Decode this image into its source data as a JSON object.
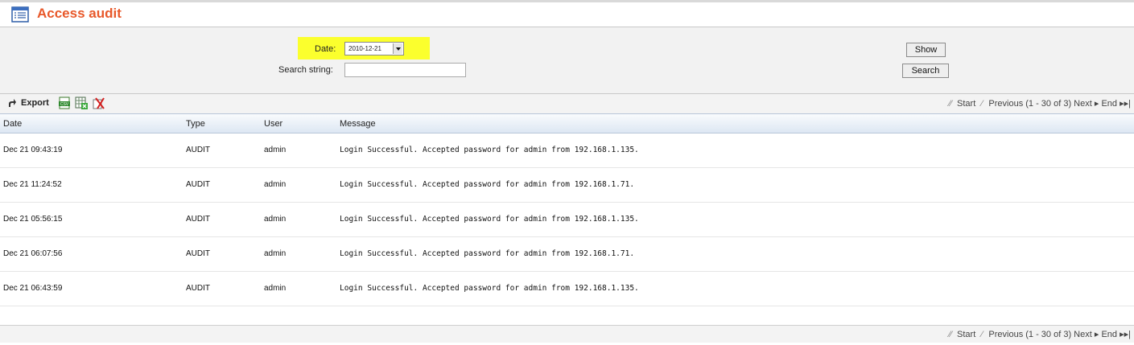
{
  "page": {
    "title": "Access audit",
    "icon": "table-list-icon"
  },
  "filters": {
    "date_label": "Date:",
    "date_value": "2010-12-21",
    "search_label": "Search string:",
    "search_value": "",
    "show_button": "Show",
    "search_button": "Search",
    "highlight_color": "#fbff2d"
  },
  "toolbar": {
    "export_label": "Export",
    "export_icons": [
      "csv-export-icon",
      "excel-export-icon",
      "delete-icon"
    ]
  },
  "pager": {
    "start": "Start",
    "previous": "Previous",
    "range": "(1 - 30 of 3)",
    "next": "Next",
    "end": "End"
  },
  "table": {
    "columns": [
      "Date",
      "Type",
      "User",
      "Message"
    ],
    "rows": [
      {
        "date": "Dec 21 09:43:19",
        "type": "AUDIT",
        "user": "admin",
        "message": "Login Successful. Accepted password for admin from 192.168.1.135."
      },
      {
        "date": "Dec 21 11:24:52",
        "type": "AUDIT",
        "user": "admin",
        "message": "Login Successful. Accepted password for admin from 192.168.1.71."
      },
      {
        "date": "Dec 21 05:56:15",
        "type": "AUDIT",
        "user": "admin",
        "message": "Login Successful. Accepted password for admin from 192.168.1.135."
      },
      {
        "date": "Dec 21 06:07:56",
        "type": "AUDIT",
        "user": "admin",
        "message": "Login Successful. Accepted password for admin from 192.168.1.71."
      },
      {
        "date": "Dec 21 06:43:59",
        "type": "AUDIT",
        "user": "admin",
        "message": "Login Successful. Accepted password for admin from 192.168.1.135."
      }
    ]
  },
  "colors": {
    "title": "#e8582a",
    "header_gradient_bottom": "#dde7f3"
  }
}
